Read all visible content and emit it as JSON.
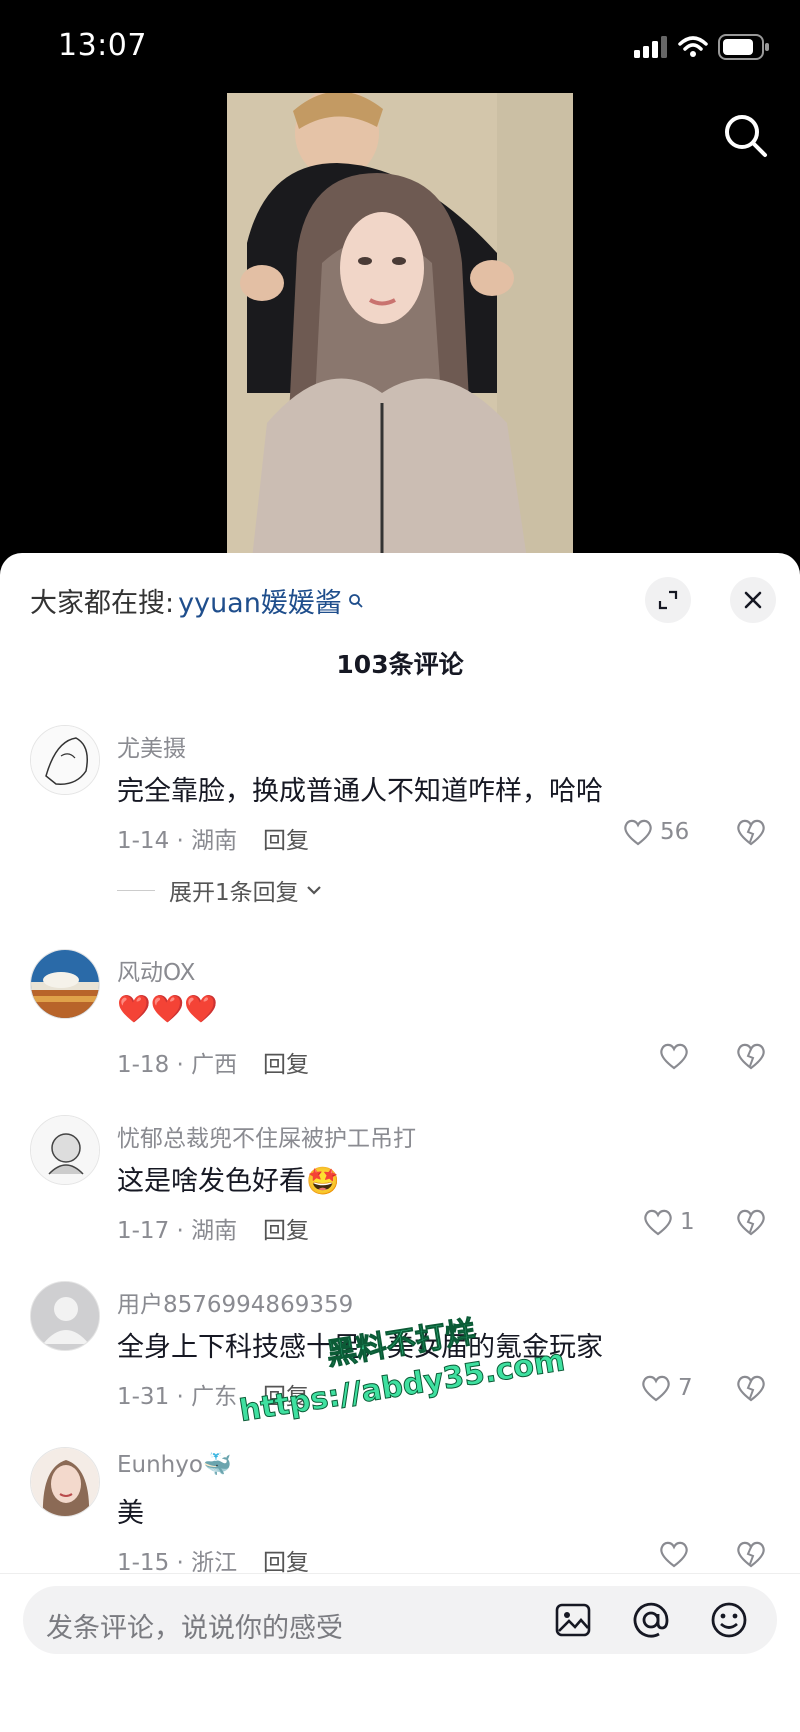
{
  "status_bar": {
    "time": "13:07"
  },
  "sheet": {
    "search_hint": {
      "prefix": "大家都在搜:",
      "keyword": "yyuan媛媛酱"
    },
    "comment_count": "103条评论",
    "comments": [
      {
        "username": "尤美摄",
        "text": "完全靠脸，换成普通人不知道咋样，哈哈",
        "date_loc": "1-14 · 湖南",
        "reply": "回复",
        "likes": "56",
        "expand": "展开1条回复"
      },
      {
        "username": "风动OX",
        "text": "❤️❤️❤️",
        "date_loc": "1-18 · 广西",
        "reply": "回复",
        "likes": ""
      },
      {
        "username": "忧郁总裁兜不住屎被护工吊打",
        "text": "这是啥发色好看🤩",
        "date_loc": "1-17 · 湖南",
        "reply": "回复",
        "likes": "1"
      },
      {
        "username": "用户8576994869359",
        "text": "全身上下科技感十足，美女届的氪金玩家",
        "date_loc": "1-31 · 广东",
        "reply": "回复",
        "likes": "7"
      },
      {
        "username": "Eunhyo🐳",
        "text": "美",
        "date_loc": "1-15 · 浙江",
        "reply": "回复",
        "likes": ""
      }
    ]
  },
  "watermark": {
    "line1": "黑料不打烊",
    "line2": "https://abdy35.com"
  },
  "input": {
    "placeholder": "发条评论，说说你的感受"
  },
  "icons": [
    "search-icon",
    "expand-icon",
    "close-icon",
    "heart-icon",
    "dislike-icon",
    "image-icon",
    "at-icon",
    "emoji-icon",
    "chevron-down-icon"
  ]
}
